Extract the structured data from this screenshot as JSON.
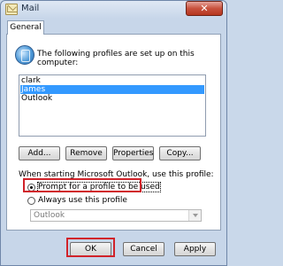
{
  "window": {
    "title": "Mail",
    "close_label": "✕"
  },
  "tabs": {
    "general": "General"
  },
  "profiles": {
    "header": "The following profiles are set up on this computer:",
    "items": [
      "clark",
      "James",
      "Outlook"
    ],
    "selected_index": 1
  },
  "profile_buttons": {
    "add": "Add...",
    "remove": "Remove",
    "properties": "Properties",
    "copy": "Copy..."
  },
  "startup": {
    "prompt_text": "When starting Microsoft Outlook, use this profile:",
    "option_prompt": "Prompt for a profile to be used",
    "option_always": "Always use this profile",
    "selected_option": "prompt",
    "profile_select_value": "Outlook"
  },
  "dialog_buttons": {
    "ok": "OK",
    "cancel": "Cancel",
    "apply": "Apply"
  },
  "colors": {
    "highlight": "#d1232a",
    "selection": "#3399ff"
  }
}
